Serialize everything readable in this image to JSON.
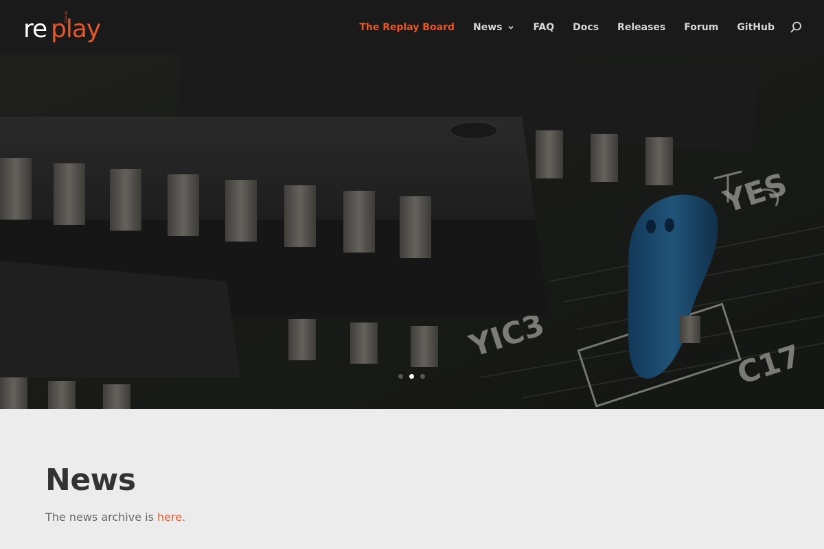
{
  "header": {
    "logo_alt": "replay",
    "logo_subtitle": "FPGA ARCADE",
    "accent_color": "#e8562a",
    "nav": [
      {
        "label": "The Replay Board",
        "active": true
      },
      {
        "label": "News",
        "has_dropdown": true
      },
      {
        "label": "FAQ"
      },
      {
        "label": "Docs"
      },
      {
        "label": "Releases"
      },
      {
        "label": "Forum"
      },
      {
        "label": "GitHub"
      }
    ],
    "search_icon": "search-icon"
  },
  "hero": {
    "slider_dots": 3,
    "active_slide": 2
  },
  "news": {
    "title": "News",
    "text_before": "The news archive is ",
    "link_text": "here."
  }
}
